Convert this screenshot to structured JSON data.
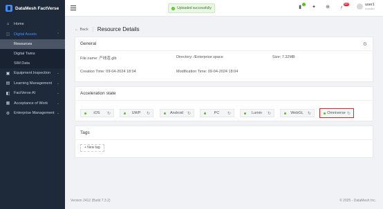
{
  "brand": {
    "name": "DataMesh FactVerse"
  },
  "sidebar": {
    "items": [
      {
        "label": "Home",
        "icon": "home-icon"
      },
      {
        "label": "Digital Assets",
        "icon": "digital-assets-icon",
        "expanded": true
      },
      {
        "label": "Equipment Inspection",
        "icon": "inspection-icon"
      },
      {
        "label": "Learning Management",
        "icon": "learning-icon"
      },
      {
        "label": "FactVerse AI",
        "icon": "ai-icon"
      },
      {
        "label": "Acceptance of Work",
        "icon": "acceptance-icon"
      },
      {
        "label": "Enterprise Management",
        "icon": "enterprise-icon"
      }
    ],
    "subitems": [
      {
        "label": "Resources",
        "selected": true
      },
      {
        "label": "Digital Twins"
      },
      {
        "label": "SIM Data"
      }
    ]
  },
  "topbar": {
    "toast": "Uploaded successfully",
    "notification_count": "99+",
    "user_name": "user1",
    "user_role": "Installer"
  },
  "page": {
    "back_label": "Back",
    "title": "Resource Details"
  },
  "general": {
    "title": "General",
    "file_name_label": "File name:",
    "file_name": "产线渲.glb",
    "directory_label": "Directory:",
    "directory": "/Enterprise space",
    "size_label": "Size:",
    "size": "7.32MB",
    "creation_label": "Creation Time:",
    "creation_time": "09-04-2024 18:04",
    "modification_label": "Modification Time:",
    "modification_time": "09-04-2024 18:04"
  },
  "acceleration": {
    "title": "Acceleration state",
    "platforms": [
      "iOS",
      "UWP",
      "Android",
      "PC",
      "Lumin",
      "WebGL",
      "Omniverse"
    ],
    "highlighted": "Omniverse"
  },
  "tags": {
    "title": "Tags",
    "new_tag_label": "+ New tag"
  },
  "footer": {
    "version": "Version 2412 (Build 7.3.2)",
    "copyright": "© 2025 - DataMesh Inc."
  },
  "colors": {
    "sidebar_bg": "#1e2a3a",
    "accent": "#3c8dff",
    "success": "#52c41a",
    "highlight_border": "#e0231d"
  }
}
